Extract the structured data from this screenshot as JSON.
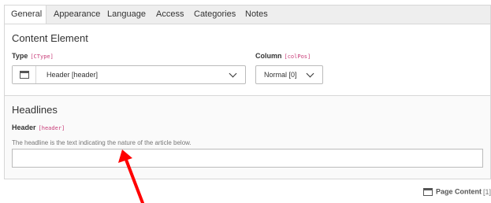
{
  "tabs": [
    {
      "label": "General",
      "active": true
    },
    {
      "label": "Appearance",
      "active": false
    },
    {
      "label": "Language",
      "active": false
    },
    {
      "label": "Access",
      "active": false
    },
    {
      "label": "Categories",
      "active": false
    },
    {
      "label": "Notes",
      "active": false
    }
  ],
  "content_element": {
    "title": "Content Element",
    "type_label": "Type",
    "type_key": "[CType]",
    "type_value": "Header [header]",
    "type_icon": "content-element-icon",
    "column_label": "Column",
    "column_key": "[colPos]",
    "column_value": "Normal [0]"
  },
  "headlines": {
    "title": "Headlines",
    "header_label": "Header",
    "header_key": "[header]",
    "header_description": "The headline is the text indicating the nature of the article below.",
    "header_value": ""
  },
  "footer": {
    "icon": "page-content-icon",
    "label": "Page Content",
    "uid": "[1]"
  },
  "colors": {
    "tab_background": "#eeeeee",
    "border": "#d7d7d7",
    "field_key": "#c83c78",
    "annotation_arrow": "#ff0000"
  }
}
